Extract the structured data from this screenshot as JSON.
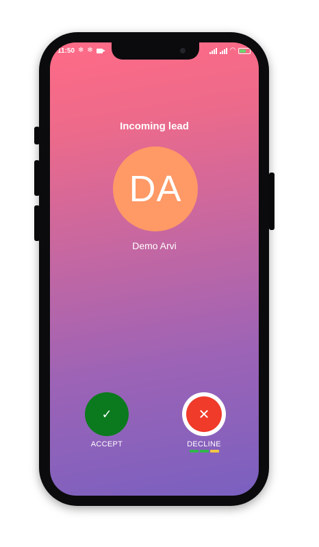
{
  "status_bar": {
    "time": "11:50",
    "left_icons": [
      "settings-icon",
      "settings-icon",
      "video-camera-icon"
    ],
    "right_icons": [
      "signal-icon",
      "signal-icon",
      "wifi-icon",
      "battery-icon"
    ],
    "battery_level": 0.7,
    "battery_color": "#6fd36f"
  },
  "call": {
    "heading": "Incoming lead",
    "avatar_initials": "DA",
    "avatar_color": "#ff9966",
    "caller_name": "Demo Arvi"
  },
  "actions": {
    "accept": {
      "label": "ACCEPT",
      "icon": "check-icon",
      "icon_glyph": "✓",
      "color": "#0b7a1e"
    },
    "decline": {
      "label": "DECLINE",
      "icon": "close-icon",
      "icon_glyph": "✕",
      "color": "#f03a2a"
    }
  },
  "colors": {
    "gradient_top": "#ff6b87",
    "gradient_bottom": "#7a60c0",
    "decline_strip": [
      "#2fb84a",
      "#2fb84a",
      "#f2c744"
    ]
  }
}
